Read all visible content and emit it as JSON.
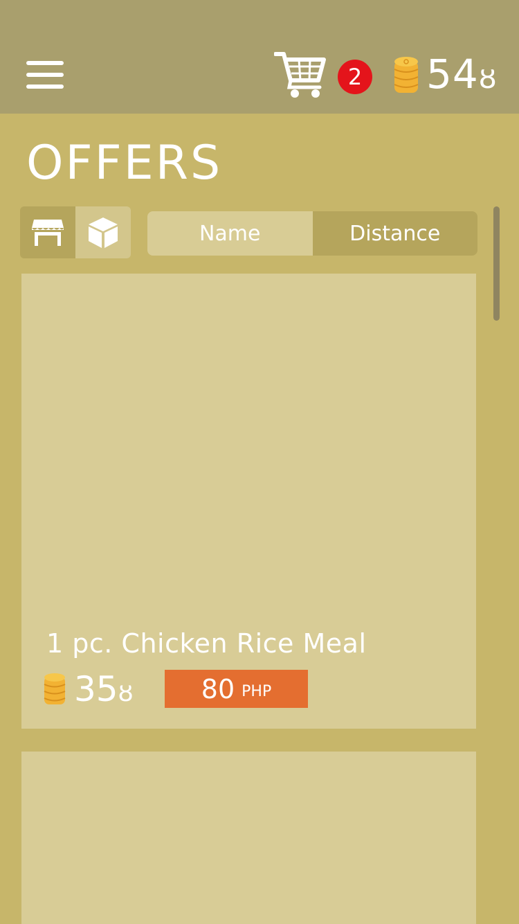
{
  "header": {
    "cart_count": "2",
    "points": "54",
    "points_unit": "ȣ",
    "colors": {
      "bar": "#a99f6d",
      "badge": "#e4141b",
      "coin": "#f2b233"
    }
  },
  "page": {
    "title": "OFFERS"
  },
  "view_toggle": {
    "options": [
      {
        "icon": "store-icon",
        "active": true
      },
      {
        "icon": "box-icon",
        "active": false
      }
    ]
  },
  "sort": {
    "options": [
      {
        "label": "Name",
        "active": false
      },
      {
        "label": "Distance",
        "active": true
      }
    ]
  },
  "offers": [
    {
      "name": "1 pc. Chicken Rice Meal",
      "points": "35",
      "points_unit": "ȣ",
      "price": "80",
      "currency": "PHP"
    },
    {}
  ],
  "colors": {
    "background": "#c7b66a",
    "card": "#d8cc96",
    "price_tag": "#e46e30",
    "accent": "#b5a55c"
  }
}
